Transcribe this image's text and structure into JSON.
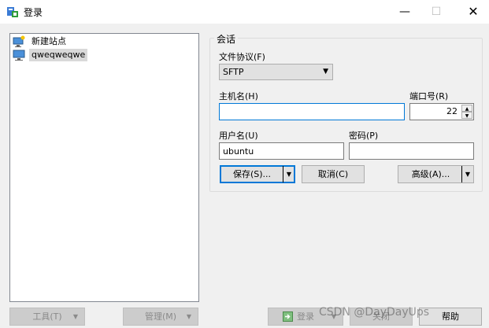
{
  "window": {
    "title": "登录"
  },
  "site_tree": {
    "items": [
      {
        "label": "新建站点",
        "icon": "new-site-icon",
        "selected": false
      },
      {
        "label": "qweqweqwe",
        "icon": "computer-icon",
        "selected": true
      }
    ]
  },
  "session": {
    "group_title": "会话",
    "protocol_label": "文件协议(F)",
    "protocol_value": "SFTP",
    "host_label": "主机名(H)",
    "host_value": "",
    "port_label": "端口号(R)",
    "port_value": "22",
    "user_label": "用户名(U)",
    "user_value": "ubuntu",
    "password_label": "密码(P)",
    "password_value": "",
    "save_label": "保存(S)...",
    "cancel_label": "取消(C)",
    "advanced_label": "高级(A)..."
  },
  "bottom": {
    "tools_label": "工具(T)",
    "manage_label": "管理(M)",
    "login_label": "登录",
    "close_label": "关闭",
    "help_label": "帮助"
  },
  "watermark": "CSDN @DayDayUps"
}
